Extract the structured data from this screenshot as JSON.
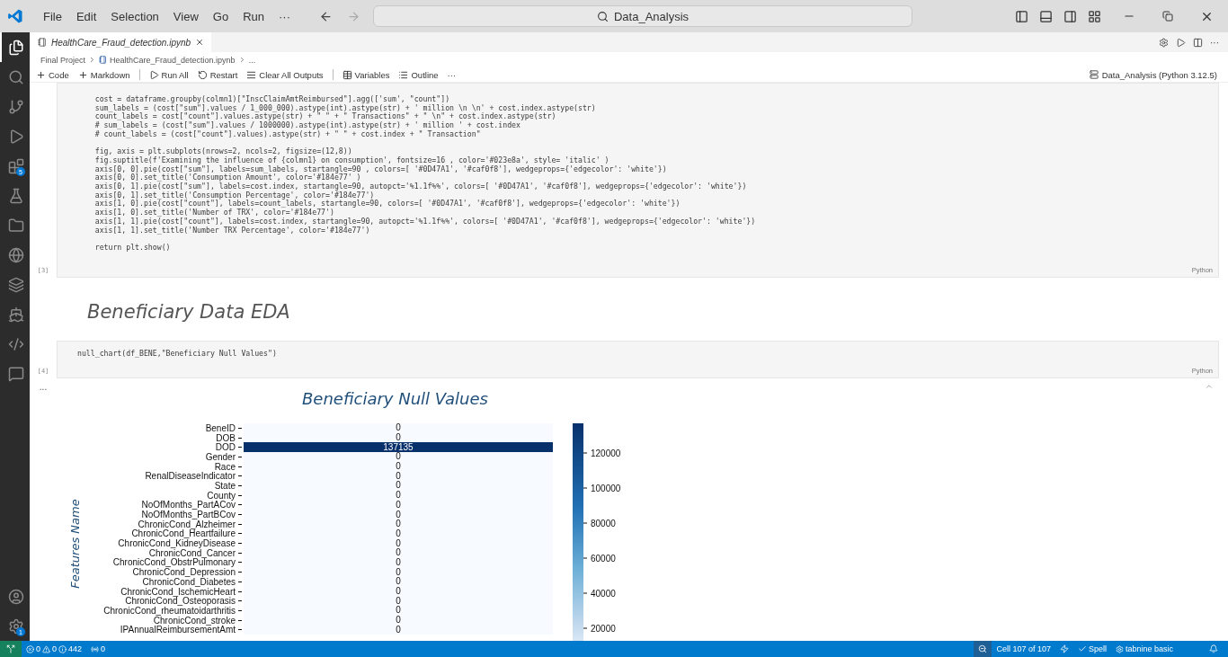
{
  "title_bar": {
    "menus": [
      "File",
      "Edit",
      "Selection",
      "View",
      "Go",
      "Run",
      "···"
    ],
    "search": "Data_Analysis"
  },
  "activity_items": [
    {
      "kind": "files",
      "selected": true
    },
    {
      "kind": "search",
      "selected": false
    },
    {
      "kind": "source-control",
      "selected": false
    },
    {
      "kind": "run",
      "selected": false
    },
    {
      "kind": "extensions",
      "selected": false,
      "badge": "5"
    },
    {
      "kind": "testing",
      "selected": false
    },
    {
      "kind": "folder",
      "selected": false
    },
    {
      "kind": "remote",
      "selected": false
    },
    {
      "kind": "layers",
      "selected": false
    },
    {
      "kind": "docker",
      "selected": false
    },
    {
      "kind": "python",
      "selected": false
    },
    {
      "kind": "chat",
      "selected": false
    }
  ],
  "activity_bottom": [
    {
      "kind": "account"
    },
    {
      "kind": "settings",
      "badge": "1"
    }
  ],
  "tab": {
    "label": "HealthCare_Fraud_detection.ipynb",
    "preview": true
  },
  "tab_more": "···",
  "breadcrumb": [
    "Final Project",
    "HealthCare_Fraud_detection.ipynb",
    "..."
  ],
  "toolbar": [
    {
      "kind": "add",
      "label": "Code"
    },
    {
      "kind": "add",
      "label": "Markdown"
    },
    {
      "kind": "run",
      "label": "Run All"
    },
    {
      "kind": "restart",
      "label": "Restart"
    },
    {
      "kind": "clear",
      "label": "Clear All Outputs"
    },
    {
      "kind": "variables",
      "label": "Variables"
    },
    {
      "kind": "outline",
      "label": "Outline"
    },
    {
      "kind": "more",
      "label": "···"
    }
  ],
  "kernel": "Data_Analysis (Python 3.12.5)",
  "cells": [
    {
      "kind": "code",
      "exec": "[3]",
      "language": "Python",
      "blocks": [
        [
          "    cost = dataframe.groupby(colmn1)[\"InscClaimAmtReimbursed\"].agg(['sum', \"count\"])",
          "    sum_labels = (cost[\"sum\"].values / 1_000_000).astype(int).astype(str) + ' million \\n \\n' + cost.index.astype(str)",
          "    count_labels = cost[\"count\"].values.astype(str) + \" \" + \" Transactions\" + \" \\n\" + cost.index.astype(str)",
          "    # sum_labels = (cost[\"sum\"].values / 1000000).astype(int).astype(str) + ' million ' + cost.index",
          "    # count_labels = (cost[\"count\"].values).astype(str) + \" \" + cost.index + \" Transaction\""
        ],
        [
          "    fig, axis = plt.subplots(nrows=2, ncols=2, figsize=(12,8))",
          "    fig.suptitle(f'Examining the influence of {colmn1} on consumption', fontsize=16 , color='#023e8a', style= 'italic' )",
          "    axis[0, 0].pie(cost[\"sum\"], labels=sum_labels, startangle=90 , colors=[ '#0D47A1', '#caf0f8'], wedgeprops={'edgecolor': 'white'})",
          "    axis[0, 0].set_title('Consumption Amount', color='#184e77' )",
          "    axis[0, 1].pie(cost[\"sum\"], labels=cost.index, startangle=90, autopct='%1.1f%%', colors=[ '#0D47A1', '#caf0f8'], wedgeprops={'edgecolor': 'white'})",
          "    axis[0, 1].set_title('Consumption Percentage', color='#184e77')",
          "    axis[1, 0].pie(cost[\"count\"], labels=count_labels, startangle=90, colors=[ '#0D47A1', '#caf0f8'], wedgeprops={'edgecolor': 'white'})",
          "    axis[1, 0].set_title('Number of TRX', color='#184e77')",
          "    axis[1, 1].pie(cost[\"count\"], labels=cost.index, startangle=90, autopct='%1.1f%%', colors=[ '#0D47A1', '#caf0f8'], wedgeprops={'edgecolor': 'white'})",
          "    axis[1, 1].set_title('Number TRX Percentage', color='#184e77')"
        ],
        [
          "    return plt.show()"
        ]
      ]
    },
    {
      "kind": "markdown",
      "heading": "Beneficiary Data EDA"
    },
    {
      "kind": "code",
      "exec": "[4]",
      "language": "Python",
      "blocks": [
        [
          "null_chart(df_BENE,\"Beneficiary Null Values\")"
        ]
      ],
      "output": {
        "more": "...",
        "heatmap": {
          "title": "Beneficiary Null Values",
          "ylabel": "Features Name",
          "colorbar_ticks": [
            "120000",
            "100000",
            "80000",
            "60000",
            "40000",
            "20000"
          ],
          "rows": [
            {
              "label": "BeneID",
              "value": "0"
            },
            {
              "label": "DOB",
              "value": "0"
            },
            {
              "label": "DOD",
              "value": "137135"
            },
            {
              "label": "Gender",
              "value": "0"
            },
            {
              "label": "Race",
              "value": "0"
            },
            {
              "label": "RenalDiseaseIndicator",
              "value": "0"
            },
            {
              "label": "State",
              "value": "0"
            },
            {
              "label": "County",
              "value": "0"
            },
            {
              "label": "NoOfMonths_PartACov",
              "value": "0"
            },
            {
              "label": "NoOfMonths_PartBCov",
              "value": "0"
            },
            {
              "label": "ChronicCond_Alzheimer",
              "value": "0"
            },
            {
              "label": "ChronicCond_Heartfailure",
              "value": "0"
            },
            {
              "label": "ChronicCond_KidneyDisease",
              "value": "0"
            },
            {
              "label": "ChronicCond_Cancer",
              "value": "0"
            },
            {
              "label": "ChronicCond_ObstrPulmonary",
              "value": "0"
            },
            {
              "label": "ChronicCond_Depression",
              "value": "0"
            },
            {
              "label": "ChronicCond_Diabetes",
              "value": "0"
            },
            {
              "label": "ChronicCond_IschemicHeart",
              "value": "0"
            },
            {
              "label": "ChronicCond_Osteoporasis",
              "value": "0"
            },
            {
              "label": "ChronicCond_rheumatoidarthritis",
              "value": "0"
            },
            {
              "label": "ChronicCond_stroke",
              "value": "0"
            },
            {
              "label": "IPAnnualReimbursementAmt",
              "value": "0"
            }
          ]
        }
      }
    }
  ],
  "status_bar": {
    "errors": "0",
    "warnings": "0",
    "infos": "442",
    "ports": "0",
    "cell": "Cell 107 of 107",
    "spell": "Spell",
    "tabnine": "tabnine basic"
  }
}
